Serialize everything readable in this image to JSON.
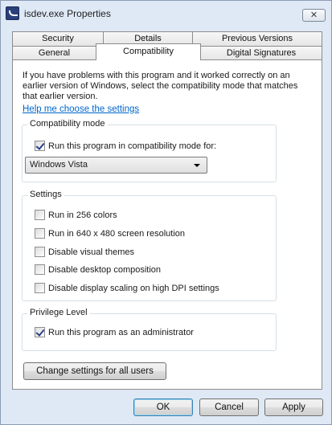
{
  "window": {
    "title": "isdev.exe Properties",
    "close_glyph": "✕",
    "app_icon": "program-icon"
  },
  "tabs": {
    "row_back": [
      "Security",
      "Details",
      "Previous Versions"
    ],
    "row_front": [
      "General",
      "Compatibility",
      "Digital Signatures"
    ],
    "active": "Compatibility"
  },
  "compatibility": {
    "intro": "If you have problems with this program and it worked correctly on an earlier version of Windows, select the compatibility mode that matches that earlier version.",
    "help_link": "Help me choose the settings",
    "mode_group": {
      "legend": "Compatibility mode",
      "checkbox_label": "Run this program in compatibility mode for:",
      "checked": true,
      "selected_os": "Windows Vista"
    },
    "settings_group": {
      "legend": "Settings",
      "options": [
        {
          "label": "Run in 256 colors",
          "checked": false
        },
        {
          "label": "Run in 640 x 480 screen resolution",
          "checked": false
        },
        {
          "label": "Disable visual themes",
          "checked": false
        },
        {
          "label": "Disable desktop composition",
          "checked": false
        },
        {
          "label": "Disable display scaling on high DPI settings",
          "checked": false
        }
      ]
    },
    "privilege_group": {
      "legend": "Privilege Level",
      "checkbox_label": "Run this program as an administrator",
      "checked": true
    },
    "change_all_button": "Change settings for all users"
  },
  "footer": {
    "ok": "OK",
    "cancel": "Cancel",
    "apply": "Apply"
  },
  "colors": {
    "window_bg": "#dfe9f5",
    "link": "#0066cc",
    "default_button_border": "#3c7fb1"
  }
}
